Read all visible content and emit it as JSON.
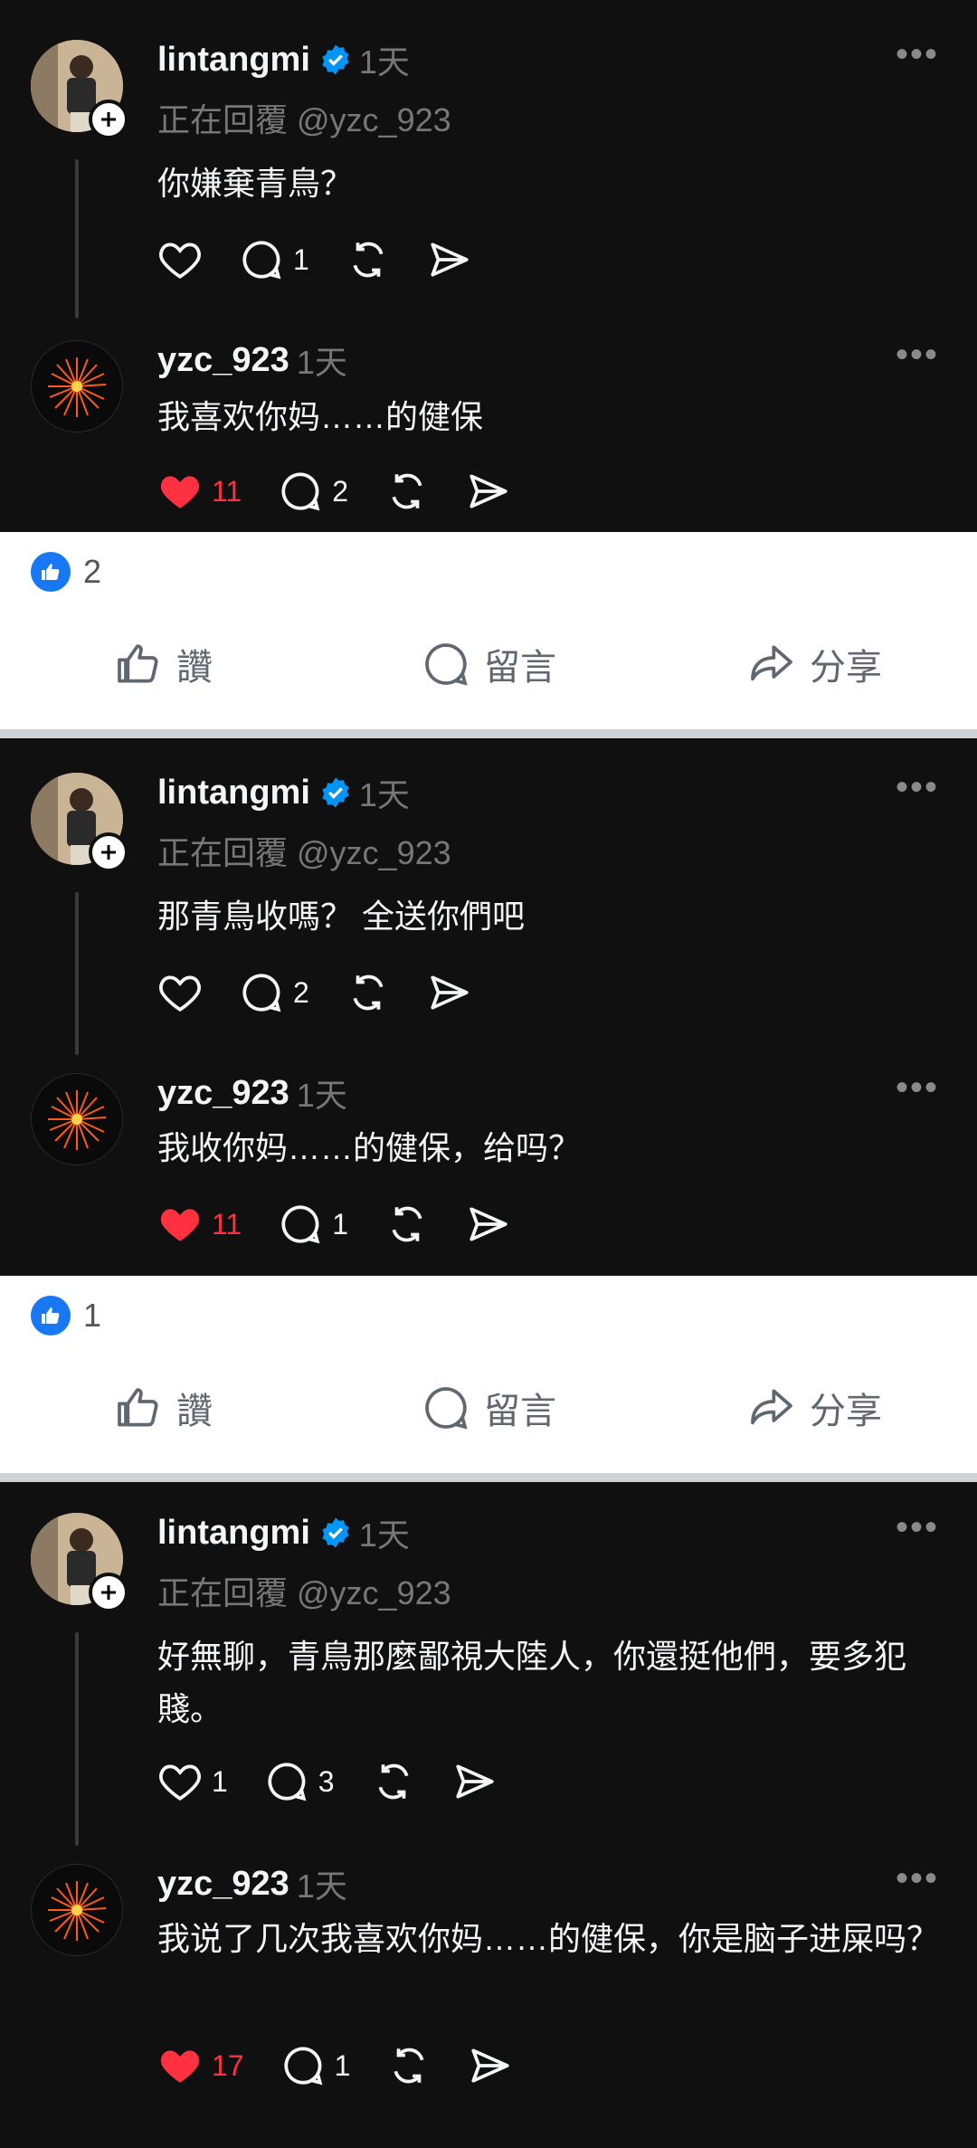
{
  "threads": [
    {
      "post": {
        "username": "lintangmi",
        "time": "1天",
        "reply_to": "正在回覆 @yzc_923",
        "text": "你嫌棄青鳥？",
        "comments": "1",
        "likes": ""
      },
      "reply": {
        "username": "yzc_923",
        "time": "1天",
        "text": "我喜欢你妈……的健保",
        "likes": "11",
        "comments": "2"
      },
      "fb_likes": "2"
    },
    {
      "post": {
        "username": "lintangmi",
        "time": "1天",
        "reply_to": "正在回覆 @yzc_923",
        "text": "那青鳥收嗎？ 全送你們吧",
        "comments": "2",
        "likes": ""
      },
      "reply": {
        "username": "yzc_923",
        "time": "1天",
        "text": "我收你妈……的健保，给吗？",
        "likes": "11",
        "comments": "1"
      },
      "fb_likes": "1"
    },
    {
      "post": {
        "username": "lintangmi",
        "time": "1天",
        "reply_to": "正在回覆 @yzc_923",
        "text": "好無聊，青鳥那麼鄙視大陸人，你還挺他們，要多犯賤。",
        "likes": "1",
        "comments": "3"
      },
      "reply": {
        "username": "yzc_923",
        "time": "1天",
        "text": "我说了几次我喜欢你妈……的健保，你是脑子进屎吗？",
        "likes": "17",
        "comments": "1"
      }
    }
  ],
  "fb_actions": {
    "like": "讚",
    "comment": "留言",
    "share": "分享"
  },
  "more_glyph": "•••",
  "colors": {
    "accent_red": "#ff3040",
    "fb_blue": "#1877f2",
    "dark_bg": "#101010"
  }
}
